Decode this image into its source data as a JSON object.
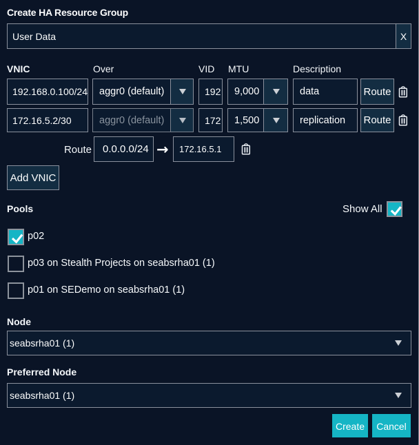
{
  "dialog": {
    "title": "Create HA Resource Group"
  },
  "name_field": {
    "value": "User Data",
    "clear_label": "X"
  },
  "vnic_table": {
    "headers": {
      "vnic": "VNIC",
      "over": "Over",
      "vid": "VID",
      "mtu": "MTU",
      "description": "Description"
    },
    "rows": [
      {
        "vnic": "192.168.0.100/24",
        "over": "aggr0 (default)",
        "vid": "192",
        "mtu": "9,000",
        "description": "data",
        "route_label": "Route",
        "over_disabled": false
      },
      {
        "vnic": "172.16.5.2/30",
        "over": "aggr0 (default)",
        "vid": "172",
        "mtu": "1,500",
        "description": "replication",
        "route_label": "Route",
        "over_disabled": true
      }
    ],
    "route_editor": {
      "label": "Route",
      "destination": "0.0.0.0/24",
      "arrow": "→",
      "gateway": "172.16.5.1"
    },
    "add_vnic_label": "Add VNIC"
  },
  "pools": {
    "label": "Pools",
    "show_all_label": "Show All",
    "show_all_checked": true,
    "items": [
      {
        "label": "p02",
        "checked": true
      },
      {
        "label": "p03 on Stealth Projects on seabsrha01 (1)",
        "checked": false
      },
      {
        "label": "p01 on SEDemo on seabsrha01 (1)",
        "checked": false
      }
    ]
  },
  "node": {
    "label": "Node",
    "value": "seabsrha01 (1)"
  },
  "preferred_node": {
    "label": "Preferred Node",
    "value": "seabsrha01 (1)"
  },
  "actions": {
    "create_label": "Create",
    "cancel_label": "Cancel"
  },
  "colors": {
    "background": "#0a1426",
    "field": "#0b1a2e",
    "face": "#132d42",
    "border": "#8b919d",
    "accent": "#15b5c5"
  }
}
